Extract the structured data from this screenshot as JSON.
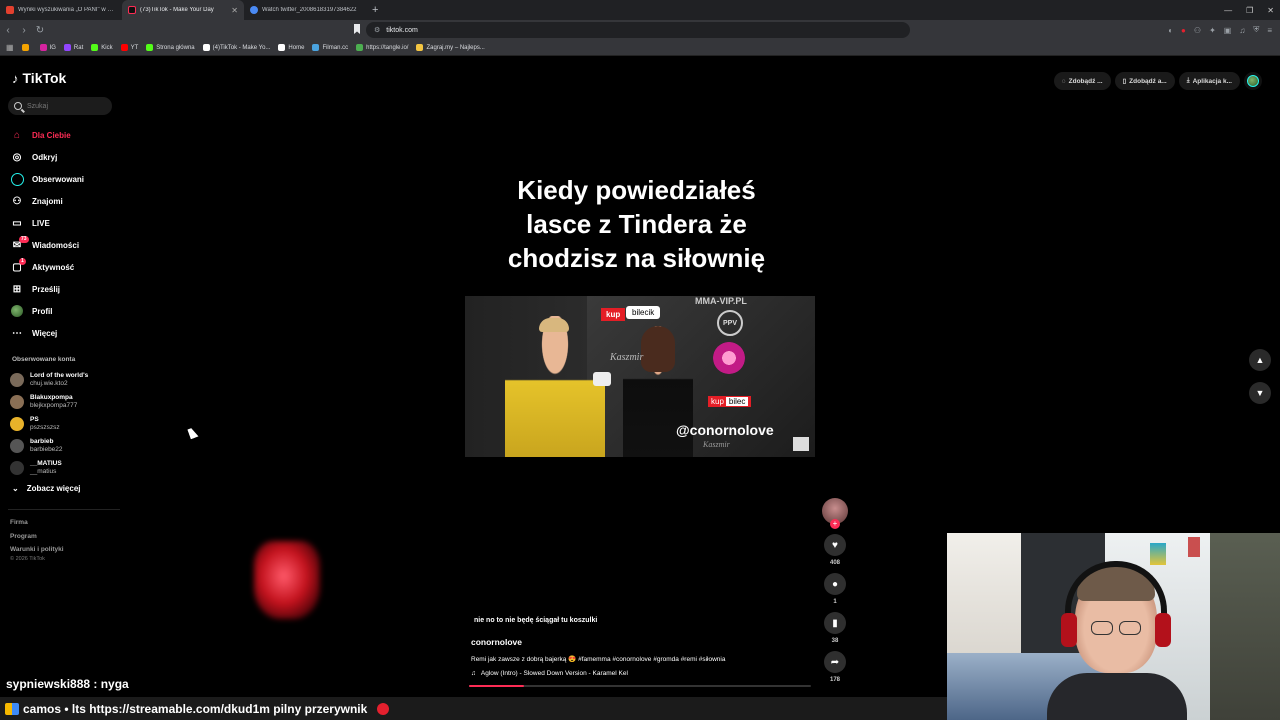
{
  "browser": {
    "tabs": [
      {
        "title": "Wyniki wyszukiwania „O PANI\" w sen",
        "color": "#e3402e",
        "active": false
      },
      {
        "title": "(73)TikTok - Make Your Day",
        "color": "#fe2c55",
        "active": true
      },
      {
        "title": "Watch twitter_20086183197384622",
        "color": "#4a8af4",
        "active": false
      }
    ],
    "new_tab": "+",
    "url": "tiktok.com",
    "bookmarks": [
      {
        "label": "",
        "color": "#f4a300"
      },
      {
        "label": "IG",
        "color": "#d6249f"
      },
      {
        "label": "Rat",
        "color": "#9146ff"
      },
      {
        "label": "Kick",
        "color": "#53fc18"
      },
      {
        "label": "YT",
        "color": "#ff0000"
      },
      {
        "label": "Strona główna",
        "color": "#53fc18"
      },
      {
        "label": "(4)TikTok - Make Yo...",
        "color": "#ffffff"
      },
      {
        "label": "Home",
        "color": "#ffffff"
      },
      {
        "label": "Filman.cc",
        "color": "#4aa3df"
      },
      {
        "label": "https://tangle.io/",
        "color": "#4caf50"
      },
      {
        "label": "Zagraj.my – Najleps...",
        "color": "#f4c542"
      }
    ]
  },
  "sidebar": {
    "logo": "TikTok",
    "search_placeholder": "Szukaj",
    "nav": [
      {
        "label": "Dla Ciebie",
        "icon": "home-icon",
        "active": true
      },
      {
        "label": "Odkryj",
        "icon": "compass-icon"
      },
      {
        "label": "Obserwowani",
        "icon": "following-icon"
      },
      {
        "label": "Znajomi",
        "icon": "friends-icon"
      },
      {
        "label": "LIVE",
        "icon": "live-icon"
      },
      {
        "label": "Wiadomości",
        "icon": "messages-icon",
        "badge": "73"
      },
      {
        "label": "Aktywność",
        "icon": "activity-icon",
        "badge": "1"
      },
      {
        "label": "Prześlij",
        "icon": "upload-icon"
      },
      {
        "label": "Profil",
        "icon": "profile-icon"
      },
      {
        "label": "Więcej",
        "icon": "more-icon"
      }
    ],
    "following_title": "Obserwowane konta",
    "following": [
      {
        "name": "Lord of the world's",
        "handle": "chuj.wie.kto2",
        "color": "#7a6a5a"
      },
      {
        "name": "Blakuxpompa",
        "handle": "blejkxpompa777",
        "color": "#8a6f55"
      },
      {
        "name": "PS",
        "handle": "pszszszsz",
        "color": "#e8b22a"
      },
      {
        "name": "barbieb",
        "handle": "barbiebe22",
        "color": "#555"
      },
      {
        "name": "__MATIUS",
        "handle": "__matius",
        "color": "#333"
      }
    ],
    "see_more": "Zobacz więcej",
    "footer_links": [
      "Firma",
      "Program",
      "Warunki i polityki"
    ],
    "copyright": "© 2026 TikTok"
  },
  "header_pills": [
    "Zdobądź ...",
    "Zdobądź a...",
    "Aplikacja k..."
  ],
  "video": {
    "caption_lines": [
      "Kiedy powiedziałeś",
      "lasce z Tindera że",
      "chodzisz na siłownię"
    ],
    "handle_overlay": "@conornolove",
    "brand_mma": "MMA-VIP.PL",
    "brand_kup": "kup",
    "brand_bilecik": "bilecik",
    "brand_ppv": "PPV",
    "kaszmir": "Kaszmir",
    "subtitle": "nie no to nie będę ściągał tu koszulki",
    "author": "conornolove",
    "description": "Remi jak zawsze z dobrą bajerką 😍 #famemma #conornolove #gromda #remi #siłownia",
    "sound": "Aglow (Intro) - Slowed Down Version - Karamel Kel",
    "progress": 0.16
  },
  "actions": {
    "likes": "408",
    "comments": "1",
    "saves": "38",
    "shares": "178"
  },
  "stream": {
    "chat_line": "sypniewski888 : nyga",
    "ticker": "camos • lts https://streamable.com/dkud1m pilny przerywnik"
  }
}
